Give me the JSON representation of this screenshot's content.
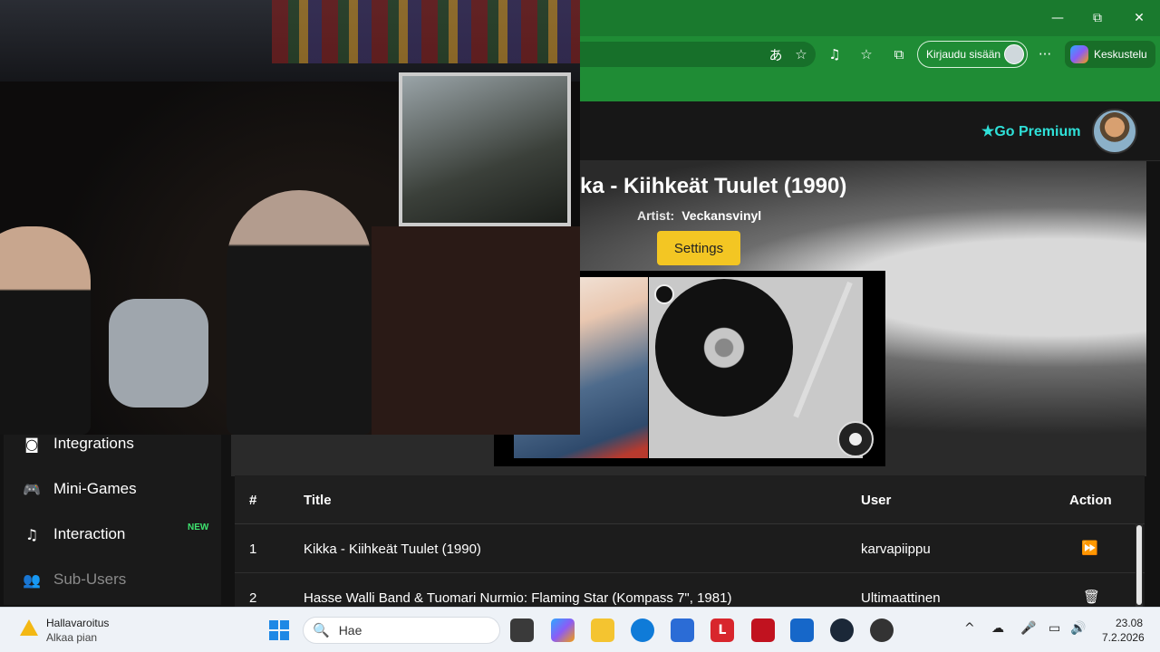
{
  "browser": {
    "window_controls": {
      "minimize": "—",
      "maximize": "⧉",
      "close": "✕"
    },
    "toolbar_icons": [
      "translate-icon",
      "favorite-star-icon",
      "music-icon",
      "favorites-icon",
      "collections-icon",
      "more-icon"
    ],
    "signin_label": "Kirjaudu sisään",
    "more_label": "···",
    "copilot_label": "Keskustelu"
  },
  "header": {
    "premium_label": "Go Premium",
    "premium_star": "★"
  },
  "now_playing": {
    "title": "ka - Kiihkeät Tuulet (1990)",
    "artist_label": "Artist:",
    "artist_value": "Veckansvinyl",
    "settings_label": "Settings"
  },
  "sidebar": {
    "items": [
      {
        "label": "Integrations",
        "icon": "discord-icon",
        "glyph": "◙"
      },
      {
        "label": "Mini-Games",
        "icon": "gamepad-icon",
        "glyph": "🎮"
      },
      {
        "label": "Interaction",
        "icon": "music-note-icon",
        "glyph": "♫"
      },
      {
        "label": "Sub-Users",
        "icon": "users-icon",
        "glyph": "👥"
      }
    ],
    "new_badge": "NEW"
  },
  "queue": {
    "columns": [
      "#",
      "Title",
      "User",
      "Action"
    ],
    "rows": [
      {
        "num": "1",
        "title": "Kikka - Kiihkeät Tuulet (1990)",
        "user": "karvapiippu",
        "action_glyph": "⏩"
      },
      {
        "num": "2",
        "title": "Hasse Walli Band & Tuomari Nurmio: Flaming Star (Kompass 7\", 1981)",
        "user": "Ultimaattinen",
        "action_glyph": "🗑"
      }
    ]
  },
  "taskbar": {
    "weather_title": "Hallavaroitus",
    "weather_sub": "Alkaa pian",
    "search_placeholder": "Hae",
    "search_glyph": "🔍",
    "clock_time": "23.08",
    "clock_date": "7.2.2026",
    "tray_up": "^",
    "tray_mic": "🎤",
    "tray_volume": "🔊"
  },
  "colors": {
    "browser_green": "#1f8c35",
    "premium_teal": "#2fe0d8",
    "settings_yellow": "#f3c623",
    "new_green": "#3ee36f"
  }
}
